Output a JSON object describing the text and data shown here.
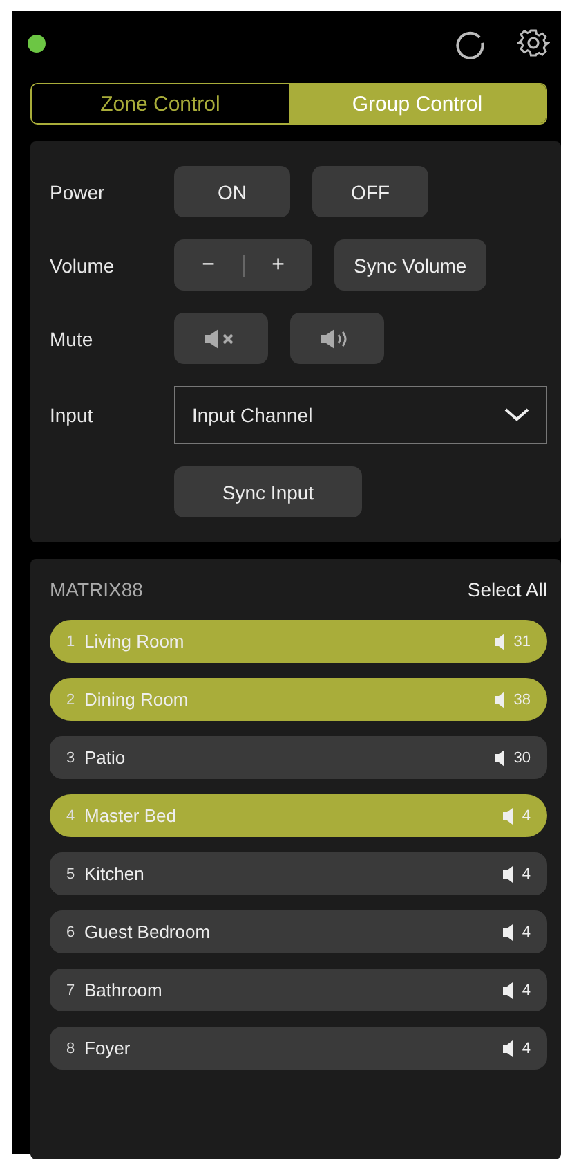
{
  "status": {
    "color": "#6cc644"
  },
  "tabs": [
    {
      "label": "Zone Control",
      "selected": false
    },
    {
      "label": "Group Control",
      "selected": true
    }
  ],
  "controls": {
    "power": {
      "label": "Power",
      "buttons": [
        "ON",
        "OFF"
      ]
    },
    "volume": {
      "label": "Volume",
      "decrease": "−",
      "increase": "+",
      "sync": "Sync Volume"
    },
    "mute": {
      "label": "Mute"
    },
    "input": {
      "label": "Input",
      "value": "Input Channel",
      "sync": "Sync Input"
    }
  },
  "zones": {
    "title": "MATRIX88",
    "select_all": "Select All",
    "items": [
      {
        "number": "1",
        "name": "Living Room",
        "volume": "31",
        "selected": true
      },
      {
        "number": "2",
        "name": "Dining Room",
        "volume": "38",
        "selected": true
      },
      {
        "number": "3",
        "name": "Patio",
        "volume": "30",
        "selected": false
      },
      {
        "number": "4",
        "name": "Master Bed",
        "volume": "4",
        "selected": true
      },
      {
        "number": "5",
        "name": "Kitchen",
        "volume": "4",
        "selected": false
      },
      {
        "number": "6",
        "name": "Guest Bedroom",
        "volume": "4",
        "selected": false
      },
      {
        "number": "7",
        "name": "Bathroom",
        "volume": "4",
        "selected": false
      },
      {
        "number": "8",
        "name": "Foyer",
        "volume": "4",
        "selected": false
      }
    ]
  }
}
